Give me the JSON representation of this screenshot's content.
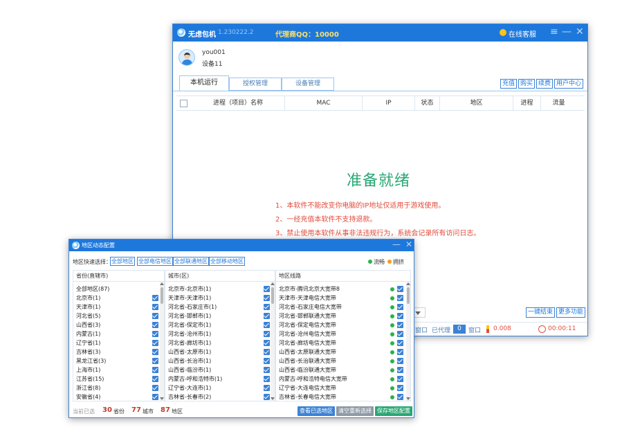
{
  "main_window": {
    "app_name": "无虑包机",
    "version": "1.230222.2",
    "agent_qq": "代理商QQ：10000",
    "online_service": "在线客服",
    "controls": {
      "menu": "≡",
      "minimize": "—",
      "close": "✕"
    },
    "user": {
      "name": "you001",
      "device": "设备11"
    },
    "tabs": [
      {
        "label": "本机运行",
        "active": true
      },
      {
        "label": "授权管理",
        "active": false
      },
      {
        "label": "设备管理",
        "active": false
      }
    ],
    "links": [
      "充值",
      "购买",
      "续费",
      "用户中心"
    ],
    "table_columns": [
      "进程（项目）名称",
      "MAC",
      "IP",
      "状态",
      "地区",
      "进程",
      "流量"
    ],
    "ready_text": "准备就绪",
    "notices": [
      "1、本软件不能改变你电脑的IP地址仅适用于游戏使用。",
      "2、一经充值本软件不支持退款。",
      "3、禁止使用本软件从事非法违规行为，系统会记录所有访问日志。"
    ],
    "buttons": {
      "one_key_end": "一键结束",
      "more_functions": "更多功能"
    },
    "status": {
      "window_suffix": "窗口",
      "proxied_label": "已代理",
      "proxied_count": "0",
      "proxied_suffix": "窗口",
      "speed": "0.008",
      "time": "00:00:11"
    },
    "colors": {
      "accent": "#1e78dc",
      "ready": "#2aa774",
      "warning": "#e34b3b"
    }
  },
  "region_dialog": {
    "title": "地区动态配置",
    "controls": {
      "minimize": "—",
      "close": "✕"
    },
    "quick_select_label": "地区快速选择：",
    "quick_buttons": [
      "全部地区",
      "全部电信地区",
      "全部联通地区",
      "全部移动地区"
    ],
    "legend": [
      {
        "label": "流畅",
        "color": "#2ab34a"
      },
      {
        "label": "拥挤",
        "color": "#f0a020"
      }
    ],
    "province_panel": {
      "header": "省份(直辖市)",
      "items": [
        "全部地区(87)",
        "北京市(1)",
        "天津市(1)",
        "河北省(5)",
        "山西省(3)",
        "内蒙古(1)",
        "辽宁省(1)",
        "吉林省(3)",
        "黑龙江省(3)",
        "上海市(1)",
        "江苏省(15)",
        "浙江省(8)",
        "安徽省(4)"
      ]
    },
    "city_panel": {
      "header": "城市(区)",
      "items": [
        "北京市-北京市(1)",
        "天津市-天津市(1)",
        "河北省-石家庄市(1)",
        "河北省-邯郸市(1)",
        "河北省-保定市(1)",
        "河北省-沧州市(1)",
        "河北省-廊坊市(1)",
        "山西省-太原市(1)",
        "山西省-长治市(1)",
        "山西省-临汾市(1)",
        "内蒙古-呼和浩特市(1)",
        "辽宁省-大连市(1)",
        "吉林省-长春市(2)"
      ]
    },
    "line_panel": {
      "header": "地区线路",
      "items": [
        "北京市-腾讯北京大宽带8",
        "天津市-天津电信大宽带",
        "河北省-石家庄电信大宽带",
        "河北省-邯郸联通大宽带",
        "河北省-保定电信大宽带",
        "河北省-沧州电信大宽带",
        "河北省-廊坊电信大宽带",
        "山西省-太原联通大宽带",
        "山西省-长治联通大宽带",
        "山西省-临汾联通大宽带",
        "内蒙古-呼和浩特电信大宽带",
        "辽宁省-大连电信大宽带",
        "吉林省-长春电信大宽带"
      ]
    },
    "footer": {
      "current_label": "当前已选",
      "province_count": "30",
      "province_unit": "省份",
      "city_count": "77",
      "city_unit": "城市",
      "region_count": "87",
      "region_unit": "地区",
      "btn_view": "查看已选地区",
      "btn_clear": "清空重新选择",
      "btn_save": "保存地区配置"
    }
  }
}
